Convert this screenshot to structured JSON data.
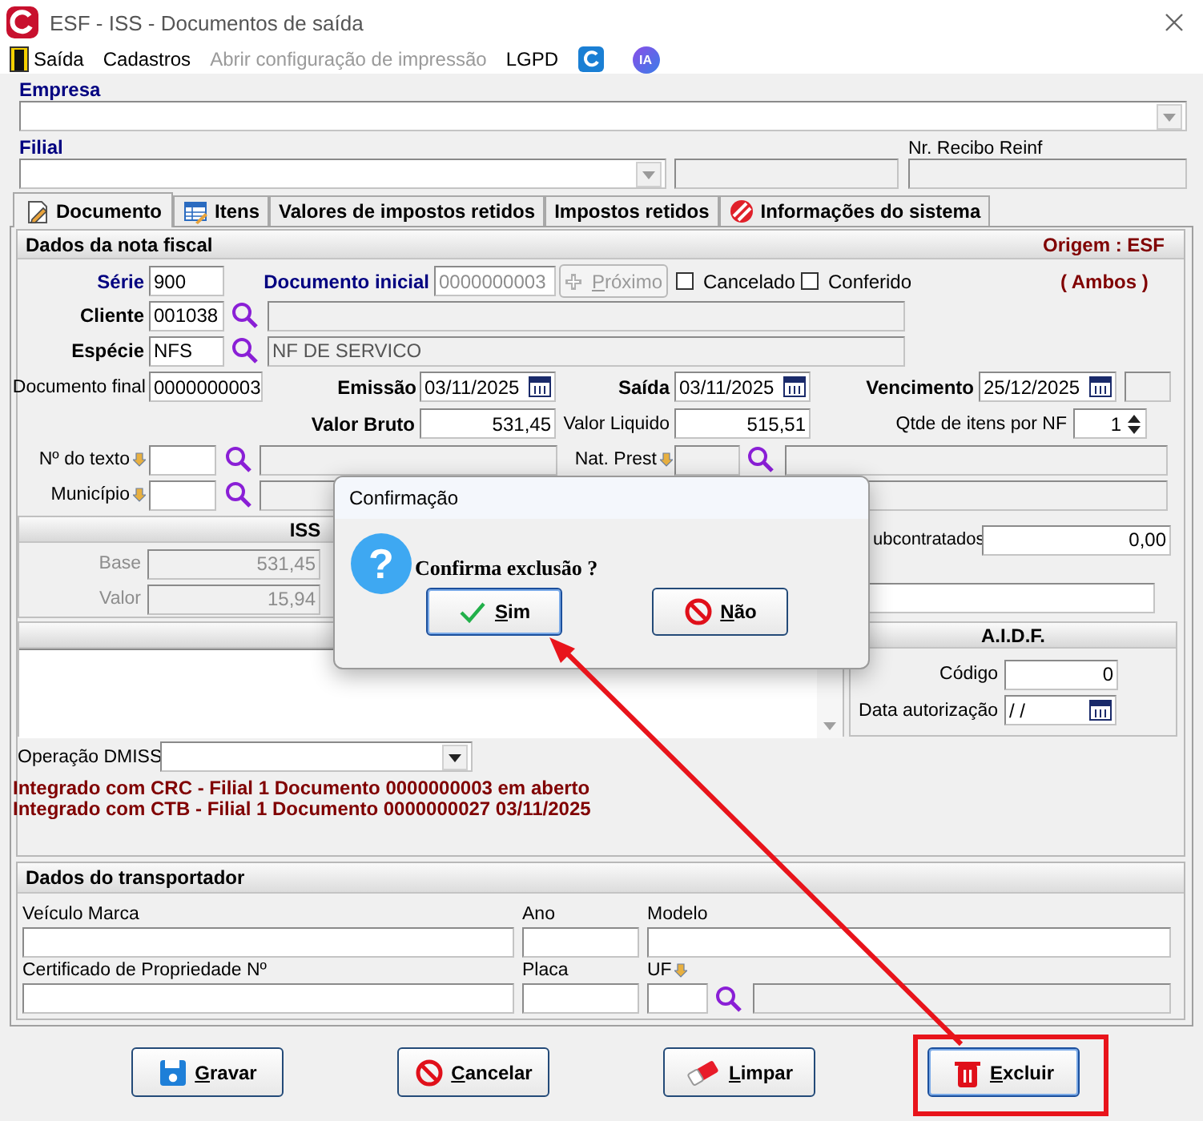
{
  "window": {
    "title": "ESF - ISS - Documentos de saída"
  },
  "menu": [
    {
      "label": "Saída",
      "disabled": false
    },
    {
      "label": "Cadastros",
      "disabled": false
    },
    {
      "label": "Abrir configuração de impressão",
      "disabled": true
    },
    {
      "label": "LGPD",
      "disabled": false
    }
  ],
  "ai_button": {
    "label": "IA"
  },
  "empresa": {
    "label": "Empresa"
  },
  "filial": {
    "label": "Filial"
  },
  "recibo_reinf": {
    "label": "Nr. Recibo Reinf"
  },
  "tabs": [
    {
      "label": "Documento",
      "selected": true,
      "kind": "document"
    },
    {
      "label": "Itens",
      "selected": false,
      "kind": "items"
    },
    {
      "label": "Valores de impostos retidos",
      "selected": false,
      "kind": "plain"
    },
    {
      "label": "Impostos retidos",
      "selected": false,
      "kind": "plain"
    },
    {
      "label": "Informações do sistema",
      "selected": false,
      "kind": "system"
    }
  ],
  "nota_fiscal": {
    "title": "Dados da nota fiscal",
    "origem": "Origem : ESF",
    "scope": "( Ambos )",
    "serie": {
      "label": "Série",
      "value": "900"
    },
    "documento_inicial": {
      "label": "Documento inicial",
      "value": "0000000003"
    },
    "proximo_button": {
      "label": "Próximo",
      "disabled": true
    },
    "checkboxes": [
      {
        "label": "Cancelado",
        "checked": false
      },
      {
        "label": "Conferido",
        "checked": false
      }
    ],
    "cliente": {
      "label": "Cliente",
      "value": "001038"
    },
    "especie": {
      "label": "Espécie",
      "value": "NFS",
      "description": "NF DE SERVICO"
    },
    "documento_final": {
      "label": "Documento final",
      "value": "0000000003"
    },
    "emissao": {
      "label": "Emissão",
      "value": "03/11/2025"
    },
    "saida": {
      "label": "Saída",
      "value": "03/11/2025"
    },
    "vencimento": {
      "label": "Vencimento",
      "value": "25/12/2025"
    },
    "valor_bruto": {
      "label": "Valor Bruto",
      "value": "531,45"
    },
    "valor_liquido": {
      "label": "Valor Liquido",
      "value": "515,51"
    },
    "qtde_itens": {
      "label": "Qtde de itens por NF",
      "value": "1"
    },
    "numero_texto": {
      "label": "Nº do texto"
    },
    "nat_prest": {
      "label": "Nat. Prest"
    },
    "municipio": {
      "label": "Município"
    },
    "iss": {
      "title": "ISS",
      "base": {
        "label": "Base",
        "value": "531,45"
      },
      "valor": {
        "label": "Valor",
        "value": "15,94"
      }
    },
    "subcontratados": {
      "label": "ubcontratados",
      "value": "0,00"
    },
    "aidf": {
      "title": "A.I.D.F.",
      "codigo": {
        "label": "Código",
        "value": "0"
      },
      "data_autorizacao": {
        "label": "Data autorização",
        "value": "/ /"
      }
    },
    "operacao_dmiss": {
      "label": "Operação DMISS"
    },
    "messages": [
      "Integrado com CRC - Filial 1 Documento 0000000003 em aberto",
      "Integrado com CTB - Filial 1 Documento 0000000027 03/11/2025"
    ]
  },
  "transportador": {
    "title": "Dados do transportador",
    "veiculo_marca": {
      "label": "Veículo Marca"
    },
    "ano": {
      "label": "Ano"
    },
    "modelo": {
      "label": "Modelo"
    },
    "certificado": {
      "label": "Certificado de Propriedade Nº"
    },
    "placa": {
      "label": "Placa"
    },
    "uf": {
      "label": "UF"
    }
  },
  "buttons": [
    {
      "label": "Gravar",
      "focused": false,
      "kind": "save"
    },
    {
      "label": "Cancelar",
      "focused": false,
      "kind": "cancel"
    },
    {
      "label": "Limpar",
      "focused": false,
      "kind": "clear"
    },
    {
      "label": "Excluir",
      "focused": true,
      "kind": "delete"
    }
  ],
  "dialog": {
    "title": "Confirmação",
    "icon": "?",
    "message": "Confirma exclusão ?",
    "buttons": [
      {
        "label": "Sim",
        "focused": true,
        "kind": "yes"
      },
      {
        "label": "Não",
        "focused": false,
        "kind": "no"
      }
    ]
  }
}
